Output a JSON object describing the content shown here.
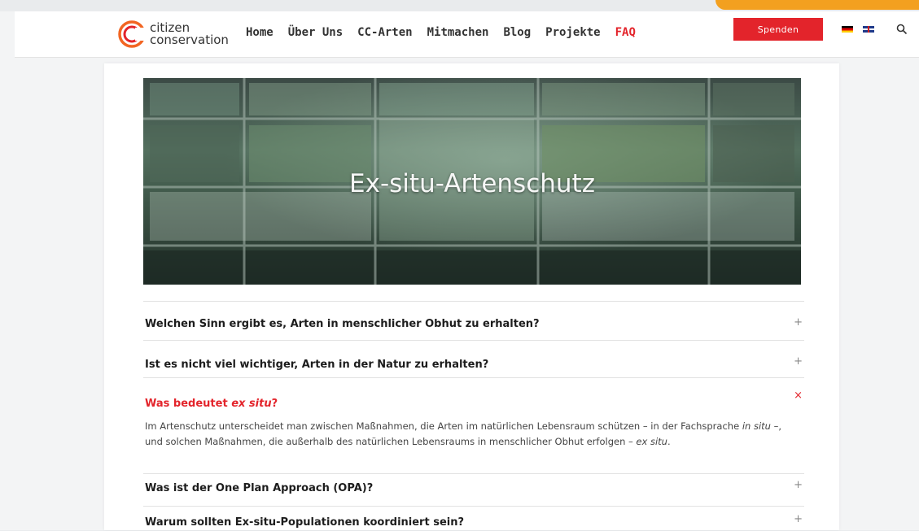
{
  "header": {
    "logo_line1": "citizen",
    "logo_line2": "conservation",
    "nav": [
      "Home",
      "Über Uns",
      "CC-Arten",
      "Mitmachen",
      "Blog",
      "Projekte",
      "FAQ"
    ],
    "active_nav": "FAQ",
    "donate_label": "Spenden",
    "icons": [
      "flag-de-icon",
      "flag-uk-icon",
      "search-icon"
    ]
  },
  "hero": {
    "title": "Ex-situ-Artenschutz"
  },
  "faq": [
    {
      "question": "Welchen Sinn ergibt es, Arten in menschlicher Obhut zu erhalten?",
      "toggle": "+"
    },
    {
      "question": "Ist es nicht viel wichtiger, Arten in der Natur zu erhalten?",
      "toggle": "+"
    },
    {
      "question_prefix": "Was bedeutet ",
      "question_em": "ex situ",
      "question_suffix": "?",
      "toggle": "×",
      "answer_1": "Im Artenschutz unterscheidet man zwischen Maßnahmen, die Arten im natürlichen Lebensraum schützen – in der Fachsprache ",
      "answer_em1": "in situ",
      "answer_2": " –, und solchen Maßnahmen, die außerhalb des natürlichen Lebensraums in menschlicher Obhut erfolgen – ",
      "answer_em2": "ex situ",
      "answer_3": "."
    },
    {
      "question": "Was ist der One Plan Approach (OPA)?",
      "toggle": "+"
    },
    {
      "question": "Warum sollten Ex-situ-Populationen koordiniert sein?",
      "toggle": "+"
    }
  ],
  "colors": {
    "accent": "#e3242b",
    "corner": "#f3a01f"
  }
}
